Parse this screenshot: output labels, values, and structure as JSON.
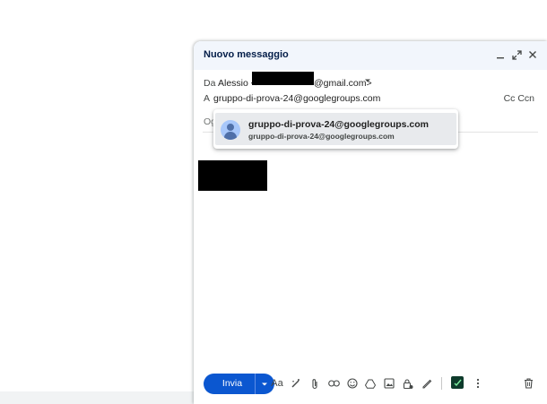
{
  "compose": {
    "title": "Nuovo messaggio",
    "from": {
      "label": "Da",
      "name": "Alessio <",
      "domain": "@gmail.com>"
    },
    "to": {
      "label": "A",
      "value": "gruppo-di-prova-24@googlegroups.com",
      "cc_label": "Cc Ccn"
    },
    "subject": {
      "placeholder": "Og"
    },
    "suggestion": {
      "name": "gruppo-di-prova-24@googlegroups.com",
      "email": "gruppo-di-prova-24@googlegroups.com"
    },
    "toolbar": {
      "send_label": "Invia",
      "format_label": "Aa"
    }
  },
  "colors": {
    "send_button": "#0b57d0",
    "header_bg": "#f2f6fc",
    "suggestion_highlight": "#e8eaed"
  },
  "icons": [
    "minimize-icon",
    "expand-icon",
    "close-icon",
    "chevron-down-icon",
    "ai-write-icon",
    "attach-icon",
    "link-icon",
    "emoji-icon",
    "drive-icon",
    "photo-icon",
    "confidential-icon",
    "signature-icon",
    "extension-icon",
    "more-icon",
    "trash-icon"
  ]
}
